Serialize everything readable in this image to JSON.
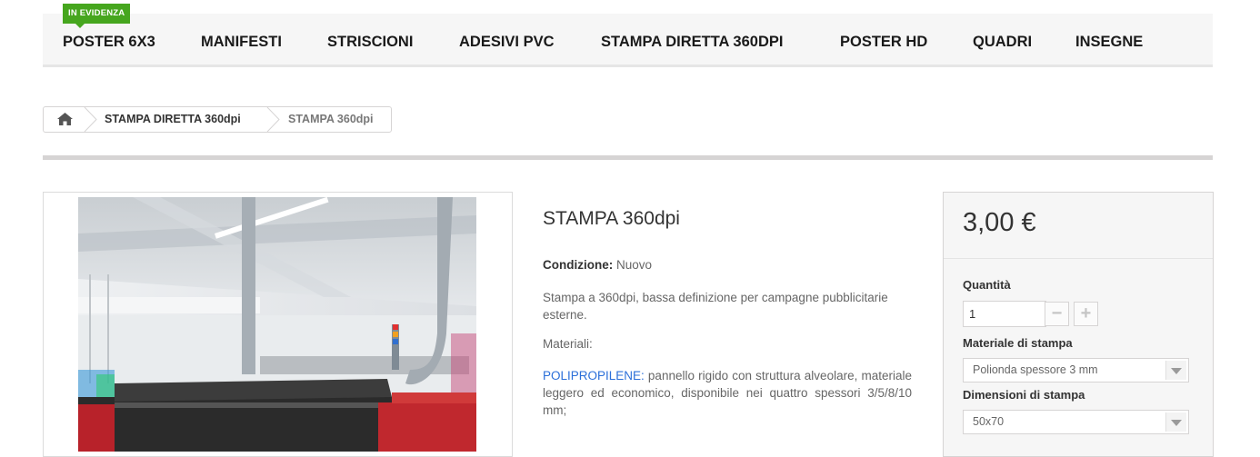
{
  "nav": {
    "badge": "IN EVIDENZA",
    "items": [
      "POSTER 6X3",
      "MANIFESTI",
      "STRISCIONI",
      "ADESIVI PVC",
      "STAMPA DIRETTA 360DPI",
      "POSTER HD",
      "QUADRI",
      "INSEGNE"
    ]
  },
  "breadcrumb": {
    "home_icon": "home-icon",
    "category": "STAMPA DIRETTA 360dpi",
    "current": "STAMPA 360dpi"
  },
  "product": {
    "title": "STAMPA 360dpi",
    "condition_label": "Condizione:",
    "condition_value": "Nuovo",
    "description": "Stampa a 360dpi, bassa definizione per campagne pubblicitarie esterne.",
    "materials_label": "Materiali:",
    "poly_name": "POLIPROPILENE:",
    "poly_text": " pannello rigido con struttura alveolare, materiale leggero ed economico, disponibile nei quattro spessori 3/5/8/10 mm;"
  },
  "buy": {
    "price": "3,00 €",
    "quantity_label": "Quantità",
    "quantity_value": "1",
    "minus_icon": "minus-icon",
    "plus_icon": "plus-icon",
    "material_label": "Materiale di stampa",
    "material_value": "Polionda spessore 3 mm",
    "dimension_label": "Dimensioni di stampa",
    "dimension_value": "50x70"
  },
  "colors": {
    "badge": "#46a61e",
    "link": "#2b6fd9",
    "divider": "#d6d4d4"
  }
}
